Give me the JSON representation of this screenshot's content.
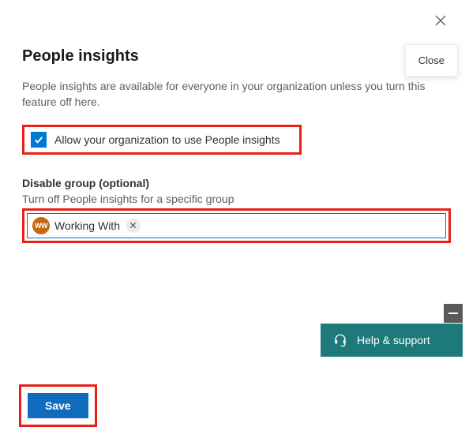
{
  "header": {
    "close_tooltip": "Close"
  },
  "title": "People insights",
  "description": "People insights are available for everyone in your organization unless you turn this feature off here.",
  "allow": {
    "checked": true,
    "label": "Allow your organization to use People insights"
  },
  "disable_group": {
    "section_label": "Disable group (optional)",
    "help_text": "Turn off People insights for a specific group",
    "chip": {
      "avatar_text": "WW",
      "label": "Working With"
    }
  },
  "help_support": {
    "label": "Help & support"
  },
  "actions": {
    "save_label": "Save"
  }
}
